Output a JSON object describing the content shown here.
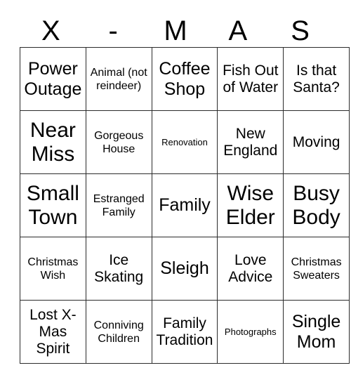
{
  "header": {
    "letters": [
      "X",
      "-",
      "M",
      "A",
      "S"
    ]
  },
  "grid": {
    "rows": [
      [
        {
          "label": "Power Outage",
          "size": "fs-lg"
        },
        {
          "label": "Animal (not reindeer)",
          "size": "fs-sm"
        },
        {
          "label": "Coffee Shop",
          "size": "fs-lg"
        },
        {
          "label": "Fish Out of Water",
          "size": "fs-md"
        },
        {
          "label": "Is that Santa?",
          "size": "fs-md"
        }
      ],
      [
        {
          "label": "Near Miss",
          "size": "fs-xl"
        },
        {
          "label": "Gorgeous House",
          "size": "fs-sm"
        },
        {
          "label": "Renovation",
          "size": "fs-xs"
        },
        {
          "label": "New England",
          "size": "fs-md"
        },
        {
          "label": "Moving",
          "size": "fs-md"
        }
      ],
      [
        {
          "label": "Small Town",
          "size": "fs-xl"
        },
        {
          "label": "Estranged Family",
          "size": "fs-sm"
        },
        {
          "label": "Family",
          "size": "fs-lg"
        },
        {
          "label": "Wise Elder",
          "size": "fs-xl"
        },
        {
          "label": "Busy Body",
          "size": "fs-xl"
        }
      ],
      [
        {
          "label": "Christmas Wish",
          "size": "fs-sm"
        },
        {
          "label": "Ice Skating",
          "size": "fs-md"
        },
        {
          "label": "Sleigh",
          "size": "fs-lg"
        },
        {
          "label": "Love Advice",
          "size": "fs-md"
        },
        {
          "label": "Christmas Sweaters",
          "size": "fs-sm"
        }
      ],
      [
        {
          "label": "Lost X-Mas Spirit",
          "size": "fs-md"
        },
        {
          "label": "Conniving Children",
          "size": "fs-sm"
        },
        {
          "label": "Family Tradition",
          "size": "fs-md"
        },
        {
          "label": "Photographs",
          "size": "fs-xs"
        },
        {
          "label": "Single Mom",
          "size": "fs-lg"
        }
      ]
    ]
  },
  "colors": {
    "border": "#2b2b2b",
    "text": "#000000",
    "background": "#ffffff"
  }
}
